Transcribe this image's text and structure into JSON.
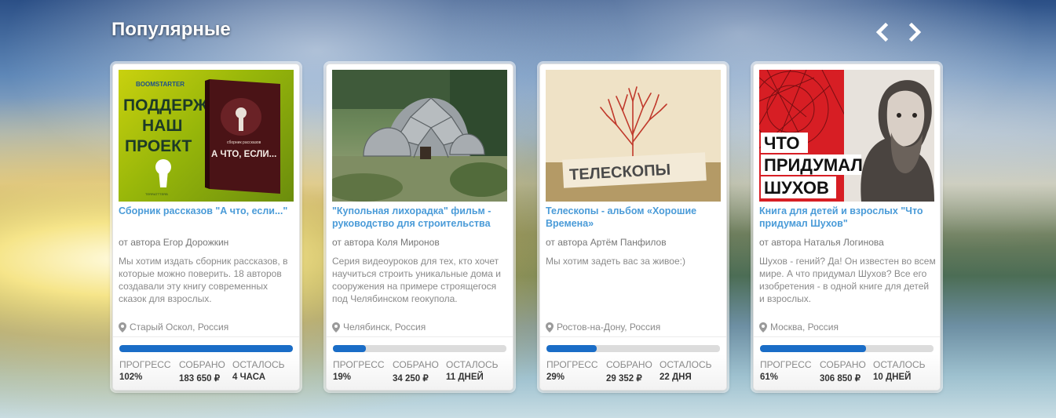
{
  "section": {
    "title": "Популярные",
    "prev_icon": "chevron-left-icon",
    "next_icon": "chevron-right-icon"
  },
  "labels": {
    "progress": "ПРОГРЕСС",
    "collected": "СОБРАНО",
    "remaining": "ОСТАЛОСЬ"
  },
  "colors": {
    "title_link": "#4a9bd8",
    "progress_fill": "#1a6dc7",
    "progress_track": "#dcdcdc"
  },
  "cards": [
    {
      "title": "Сборник рассказов \"А что, если...\"",
      "author": "от автора Егор Дорожкин",
      "description": "Мы хотим издать сборник рассказов, в которые можно поверить. 18 авторов создавали эту книгу современных сказок для взрослых.",
      "location": "Старый Оскол, Россия",
      "progress_fraction": 1.0,
      "progress": "102%",
      "collected": "183 650 ₽",
      "remaining": "4 ЧАСА",
      "image_text": {
        "brand": "BOOMSTARTER",
        "lines": [
          "ПОДДЕРЖИ",
          "НАШ",
          "ПРОЕКТ"
        ],
        "book_small": "сборник рассказов",
        "book_title": "А ЧТО, ЕСЛИ...",
        "publisher": "TERRATTTERB"
      }
    },
    {
      "title": "\"Купольная лихорадка\" фильм - руководство для строительства",
      "author": "от автора Коля Миронов",
      "description": "Серия видеоуроков для тех, кто хочет научиться строить уникальные дома и сооружения на примере строящегося под Челябинском геокупола.",
      "location": "Челябинск, Россия",
      "progress_fraction": 0.19,
      "progress": "19%",
      "collected": "34 250 ₽",
      "remaining": "11 ДНЕЙ"
    },
    {
      "title": "Телескопы - альбом «Хорошие Времена»",
      "author": "от автора Артём Панфилов",
      "description": "Мы хотим задеть вас за живое:)",
      "location": "Ростов-на-Дону, Россия",
      "progress_fraction": 0.29,
      "progress": "29%",
      "collected": "29 352 ₽",
      "remaining": "22 ДНЯ",
      "image_text": {
        "label": "ТЕЛЕСКОПЫ"
      }
    },
    {
      "title": "Книга для детей и взрослых \"Что придумал Шухов\"",
      "author": "от автора Наталья Логинова",
      "description": "Шухов - гений? Да! Он известен во всем мире. А что придумал Шухов? Все его изобретения - в одной книге для детей и взрослых.",
      "location": "Москва, Россия",
      "progress_fraction": 0.61,
      "progress": "61%",
      "collected": "306 850 ₽",
      "remaining": "10 ДНЕЙ",
      "image_text": {
        "lines": [
          "ЧТО",
          "ПРИДУМАЛ",
          "ШУХОВ"
        ]
      }
    }
  ]
}
